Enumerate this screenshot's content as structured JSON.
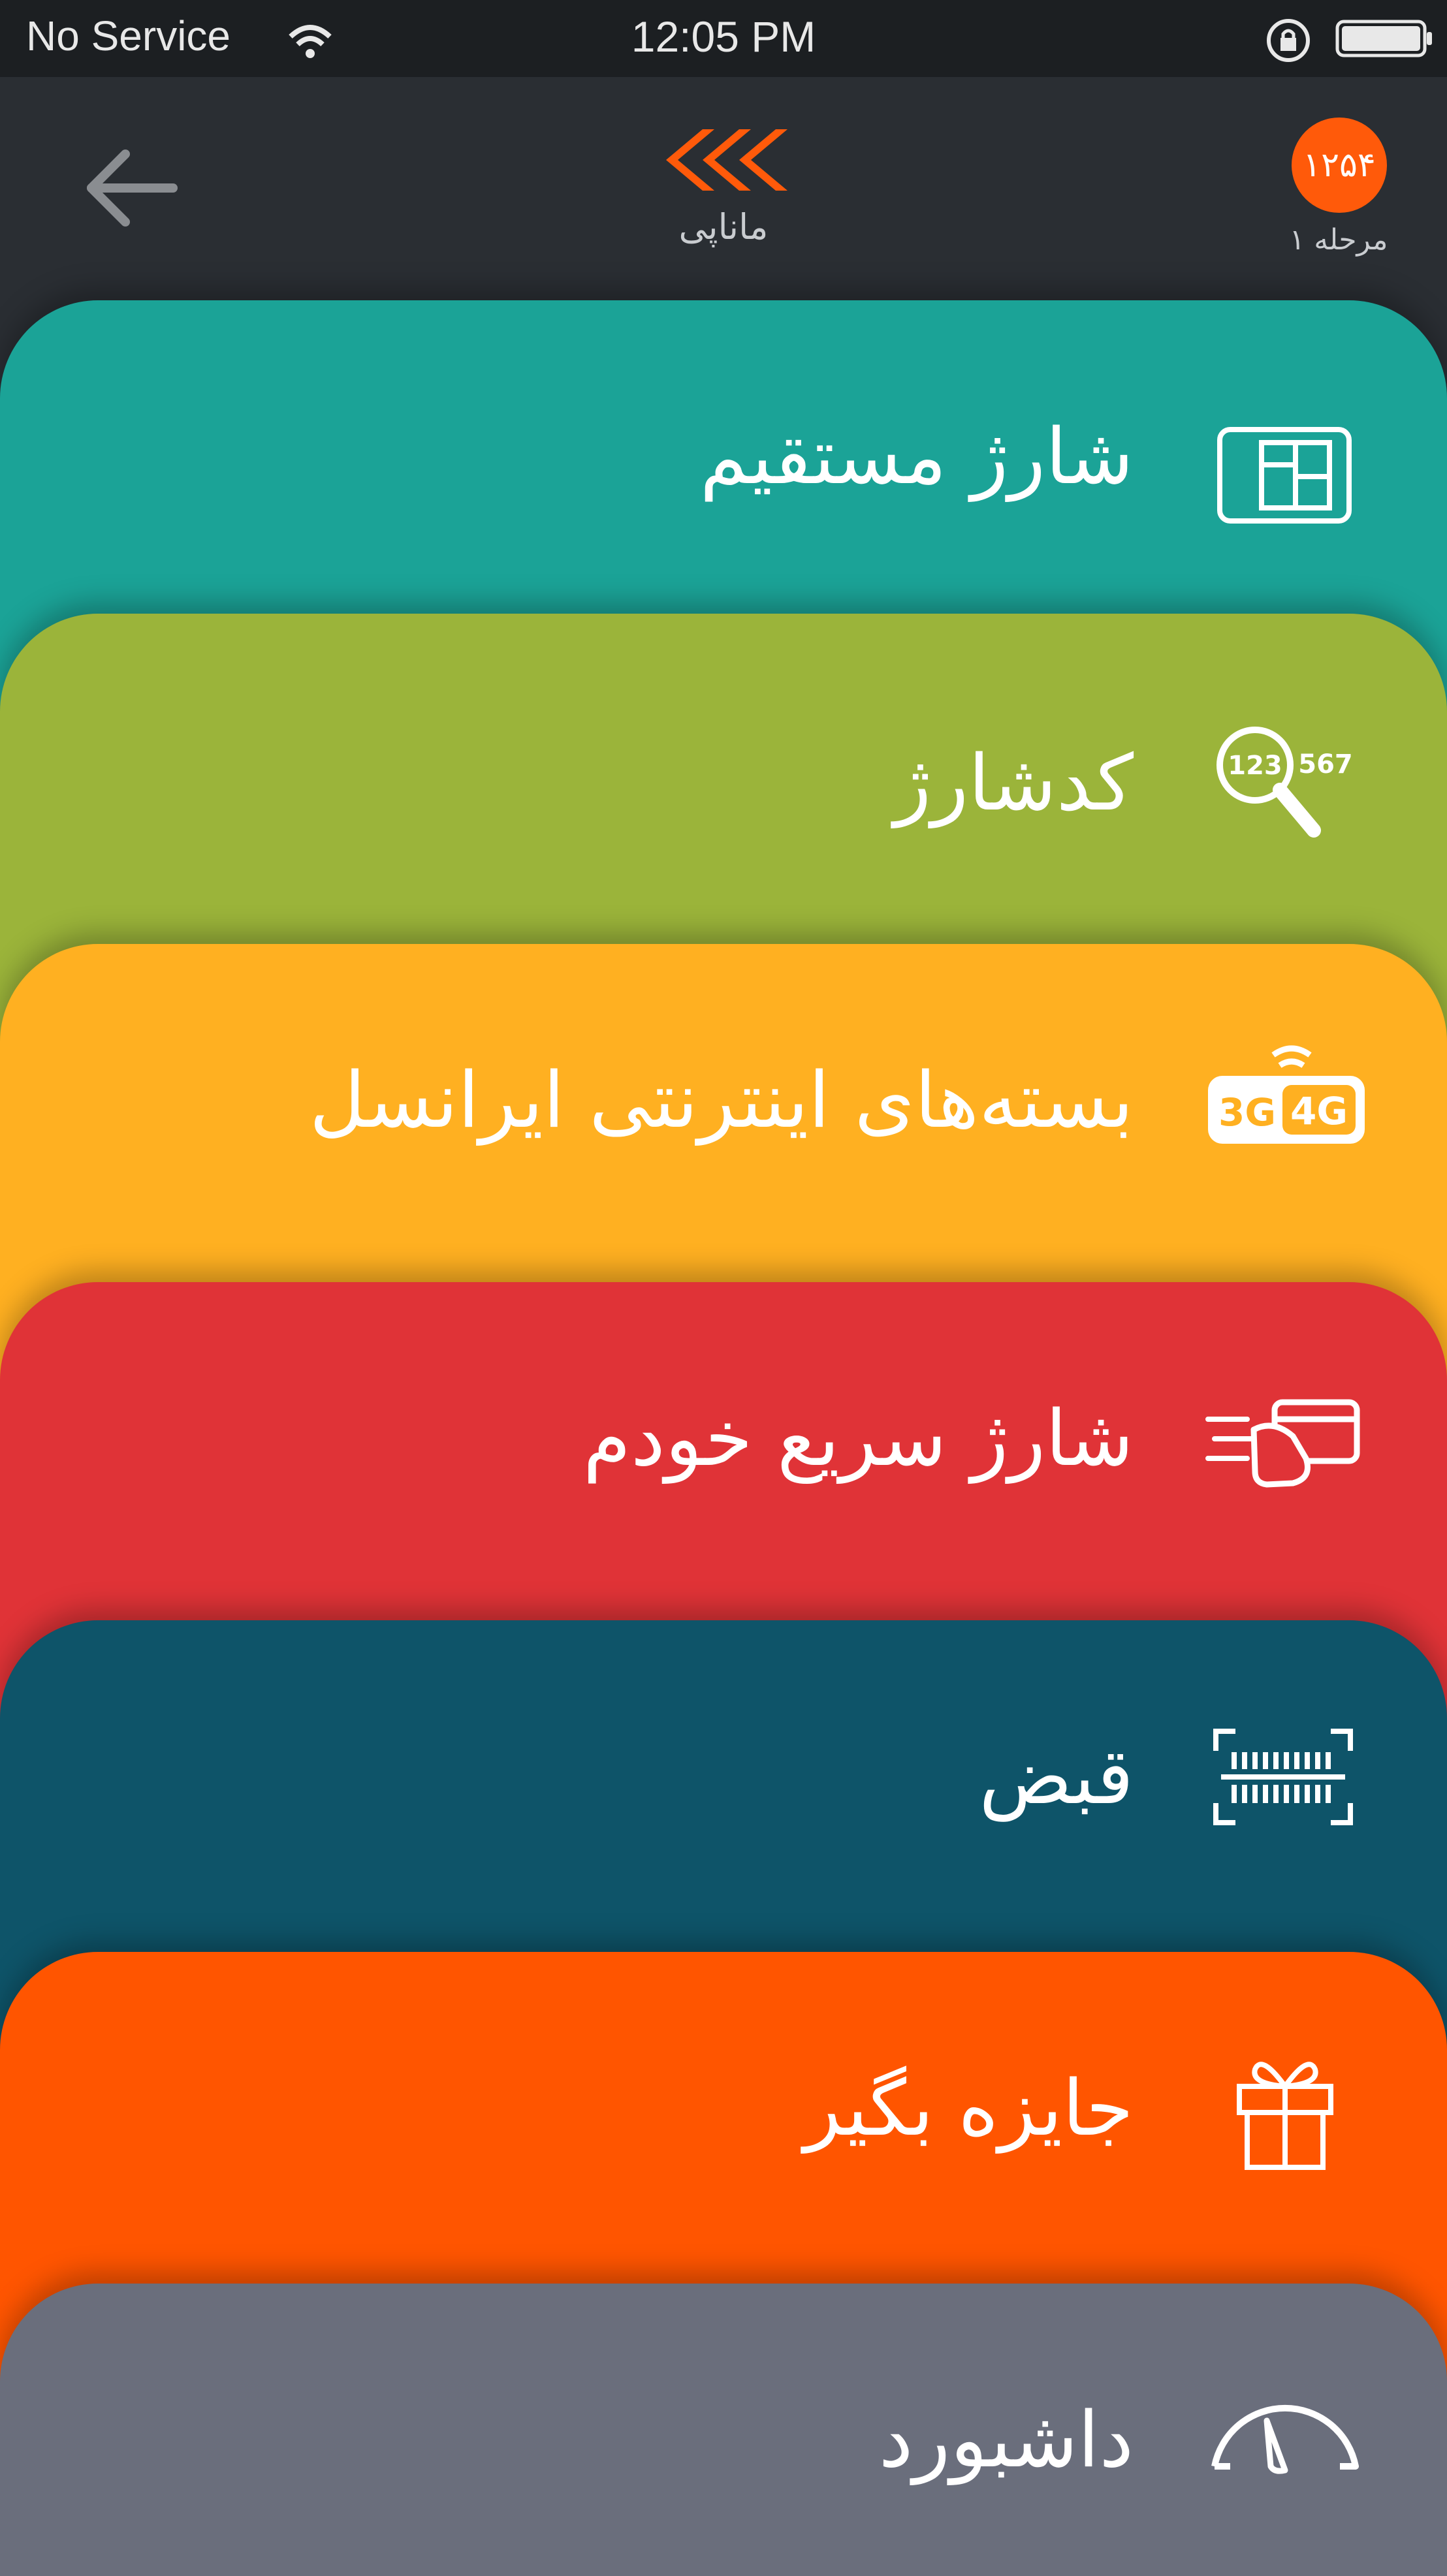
{
  "status_bar": {
    "carrier": "No Service",
    "time": "12:05 PM"
  },
  "header": {
    "logo_text": "ماناپی",
    "badge_value": "۱۲۵۴",
    "level_text": "مرحله ۱"
  },
  "menu": [
    {
      "label": "شارژ مستقیم",
      "color": "#1ba397",
      "icon": "sim-card-icon"
    },
    {
      "label": "کدشارژ",
      "color": "#9bb43a",
      "icon": "charge-code-search-icon"
    },
    {
      "label": "بسته‌های اینترنتی ایرانسل",
      "color": "#ffb021",
      "icon": "3g-4g-icon"
    },
    {
      "label": "شارژ سریع خودم",
      "color": "#e03337",
      "icon": "fast-card-icon"
    },
    {
      "label": "قبض",
      "color": "#0e5469",
      "icon": "barcode-scan-icon"
    },
    {
      "label": "جایزه بگیر",
      "color": "#ff5500",
      "icon": "gift-icon"
    },
    {
      "label": "داشبورد",
      "color": "#6a6e7c",
      "icon": "speedometer-icon"
    }
  ]
}
